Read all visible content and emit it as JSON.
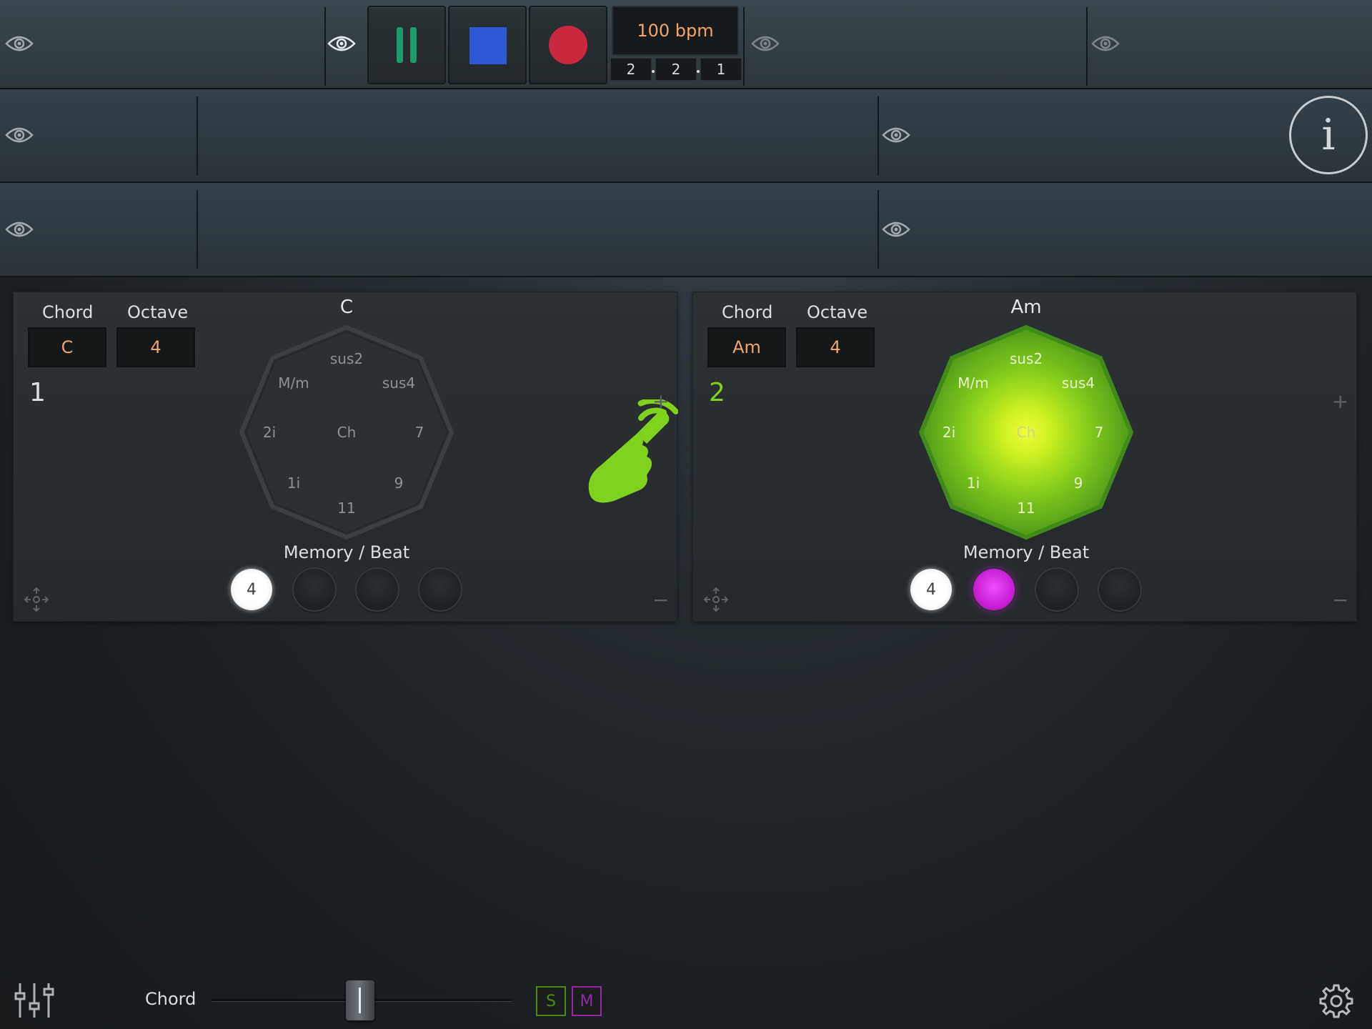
{
  "transport": {
    "bpm": "100 bpm",
    "position": [
      "2",
      "2",
      "1"
    ]
  },
  "panels": [
    {
      "chord_label": "Chord",
      "octave_label": "Octave",
      "chord_value": "C",
      "octave_value": "4",
      "index": "1",
      "chord_name": "C",
      "wheel": {
        "top": "sus2",
        "top_left": "M/m",
        "top_right": "sus4",
        "left": "2i",
        "center": "Ch",
        "right": "7",
        "bottom_left": "1i",
        "bottom_right": "9",
        "bottom": "11"
      },
      "memory_label": "Memory / Beat",
      "memory_slots": [
        "4",
        "",
        "",
        ""
      ],
      "active": false
    },
    {
      "chord_label": "Chord",
      "octave_label": "Octave",
      "chord_value": "Am",
      "octave_value": "4",
      "index": "2",
      "chord_name": "Am",
      "wheel": {
        "top": "sus2",
        "top_left": "M/m",
        "top_right": "sus4",
        "left": "2i",
        "center": "Ch",
        "right": "7",
        "bottom_left": "1i",
        "bottom_right": "9",
        "bottom": "11"
      },
      "memory_label": "Memory / Beat",
      "memory_slots": [
        "4",
        "",
        "",
        ""
      ],
      "active": true
    }
  ],
  "panel_controls": {
    "add": "+",
    "remove": "−"
  },
  "info_label": "i",
  "bottom": {
    "slider_label": "Chord",
    "solo_label": "S",
    "mute_label": "M"
  },
  "colors": {
    "accent_green": "#7fd21e",
    "value_orange": "#f0a66a",
    "record_red": "#c9283f",
    "stop_blue": "#2f58d6",
    "pause_teal": "#1f9a6a",
    "memory_magenta": "#d32ee0"
  },
  "icons": [
    "eye-icon",
    "pause-icon",
    "stop-icon",
    "record-icon",
    "info-icon",
    "move-icon",
    "tap-gesture-icon",
    "mixer-icon",
    "gear-icon"
  ]
}
